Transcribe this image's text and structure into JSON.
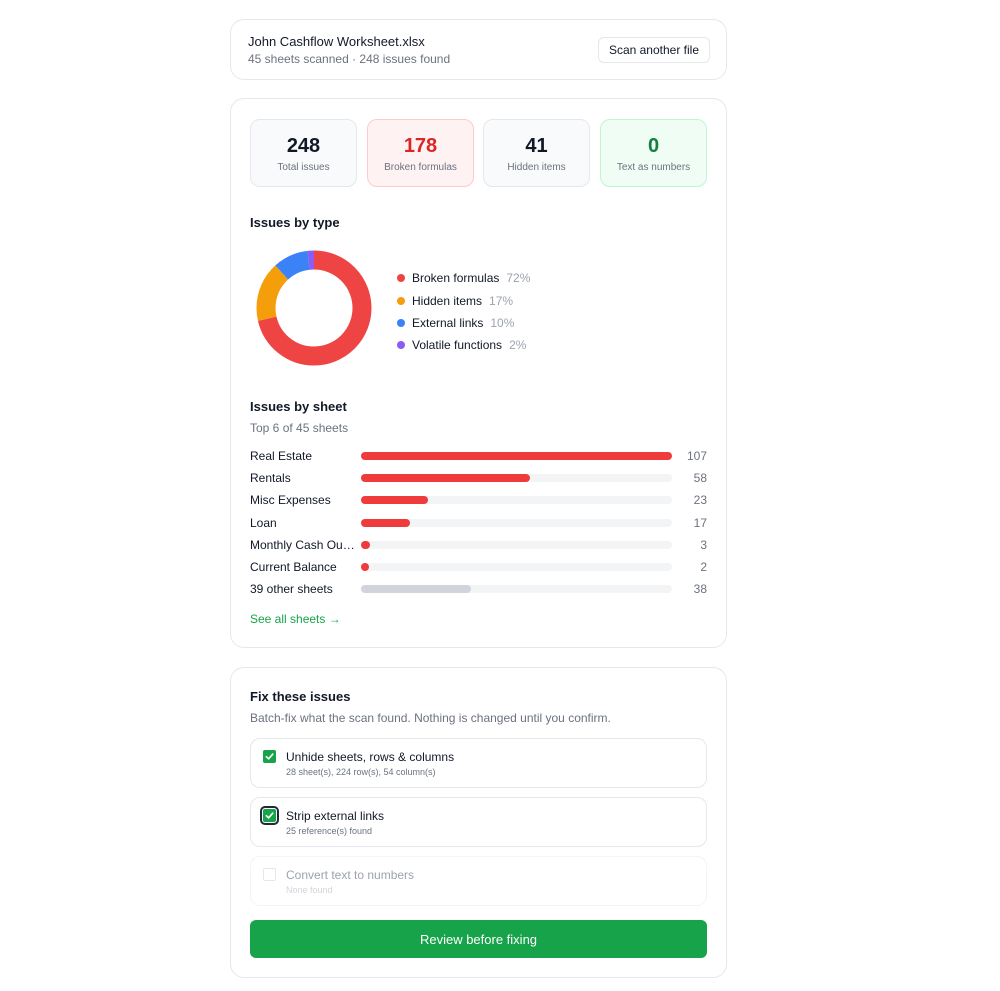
{
  "file": {
    "name": "John Cashflow Worksheet.xlsx",
    "meta": "45 sheets scanned · 248 issues found",
    "scan_another_label": "Scan another file"
  },
  "stats": [
    {
      "value": "248",
      "label": "Total issues"
    },
    {
      "value": "178",
      "label": "Broken formulas"
    },
    {
      "value": "41",
      "label": "Hidden items"
    },
    {
      "value": "0",
      "label": "Text as numbers"
    }
  ],
  "issues_by_type": {
    "title": "Issues by type",
    "items": [
      {
        "name": "Broken formulas",
        "pct": "72%",
        "value": 72,
        "color": "#ef4444"
      },
      {
        "name": "Hidden items",
        "pct": "17%",
        "value": 17,
        "color": "#f59e0b"
      },
      {
        "name": "External links",
        "pct": "10%",
        "value": 10,
        "color": "#3b82f6"
      },
      {
        "name": "Volatile functions",
        "pct": "2%",
        "value": 2,
        "color": "#8b5cf6"
      }
    ]
  },
  "issues_by_sheet": {
    "title": "Issues by sheet",
    "subtitle": "Top 6 of 45 sheets",
    "max": 107,
    "rows": [
      {
        "label": "Real Estate",
        "value": 107,
        "display": "107",
        "grey": false
      },
      {
        "label": "Rentals",
        "value": 58,
        "display": "58",
        "grey": false
      },
      {
        "label": "Misc Expenses",
        "value": 23,
        "display": "23",
        "grey": false
      },
      {
        "label": "Loan",
        "value": 17,
        "display": "17",
        "grey": false
      },
      {
        "label": "Monthly Cash Out…",
        "value": 3,
        "display": "3",
        "grey": false
      },
      {
        "label": "Current Balance",
        "value": 2,
        "display": "2",
        "grey": false
      },
      {
        "label": "39 other sheets",
        "value": 38,
        "display": "38",
        "grey": true
      }
    ],
    "see_all_label": "See all sheets →"
  },
  "fix": {
    "title": "Fix these issues",
    "subtitle": "Batch-fix what the scan found. Nothing is changed until you confirm.",
    "items": [
      {
        "title": "Unhide sheets, rows & columns",
        "sub": "28 sheet(s), 224 row(s), 54 column(s)",
        "checked": true
      },
      {
        "title": "Strip external links",
        "sub": "25 reference(s) found",
        "checked": true
      },
      {
        "title": "Convert text to numbers",
        "sub": "None found",
        "checked": false
      }
    ],
    "review_label": "Review before fixing"
  }
}
